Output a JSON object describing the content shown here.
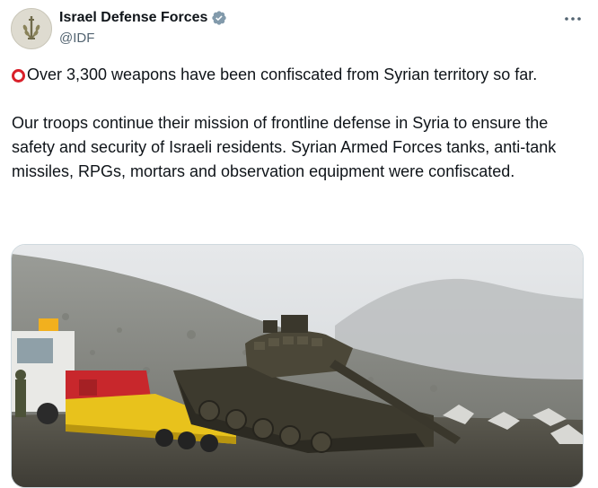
{
  "author": {
    "display_name": "Israel Defense Forces",
    "handle": "@IDF",
    "verified_icon": "verified-badge-icon",
    "avatar_icon": "idf-emblem-icon"
  },
  "tweet": {
    "lead_emoji": "red-hollow-circle-icon",
    "paragraph_1": "Over 3,300 weapons have been confiscated from Syrian territory so far.",
    "paragraph_2": "Our troops continue their mission of frontline defense in Syria to ensure the safety and security of Israeli residents. Syrian Armed Forces tanks, anti-tank missiles, RPGs, mortars and observation equipment were confiscated."
  },
  "media": {
    "type": "photo"
  },
  "colors": {
    "text": "#0f1419",
    "secondary_text": "#536471",
    "verified_blue": "#829aab",
    "emoji_red": "#d9202a",
    "border": "#cfd9de"
  }
}
